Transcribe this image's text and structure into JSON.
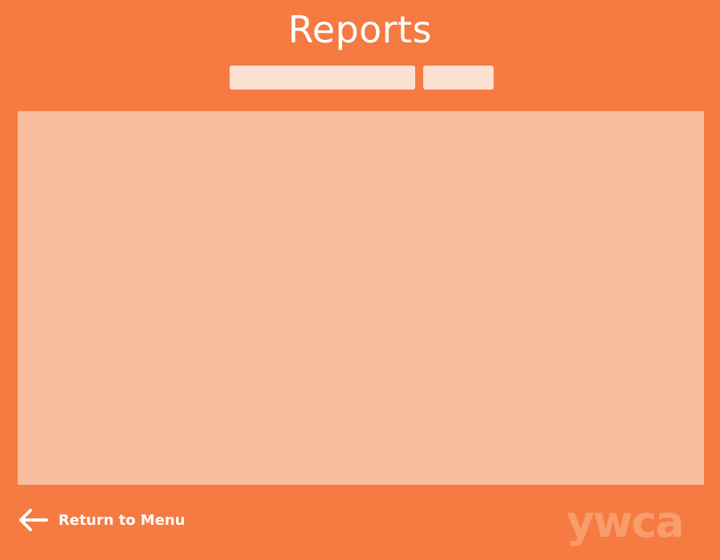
{
  "header": {
    "title": "Reports"
  },
  "filters": {
    "primary_value": "",
    "secondary_value": ""
  },
  "footer": {
    "return_label": "Return to Menu",
    "back_icon": "arrow-left-icon",
    "logo_text": "ywca"
  },
  "colors": {
    "background": "#f57b42",
    "panel": "#f9bd9f",
    "field": "#fce0d1",
    "logo": "#f89d6c"
  }
}
